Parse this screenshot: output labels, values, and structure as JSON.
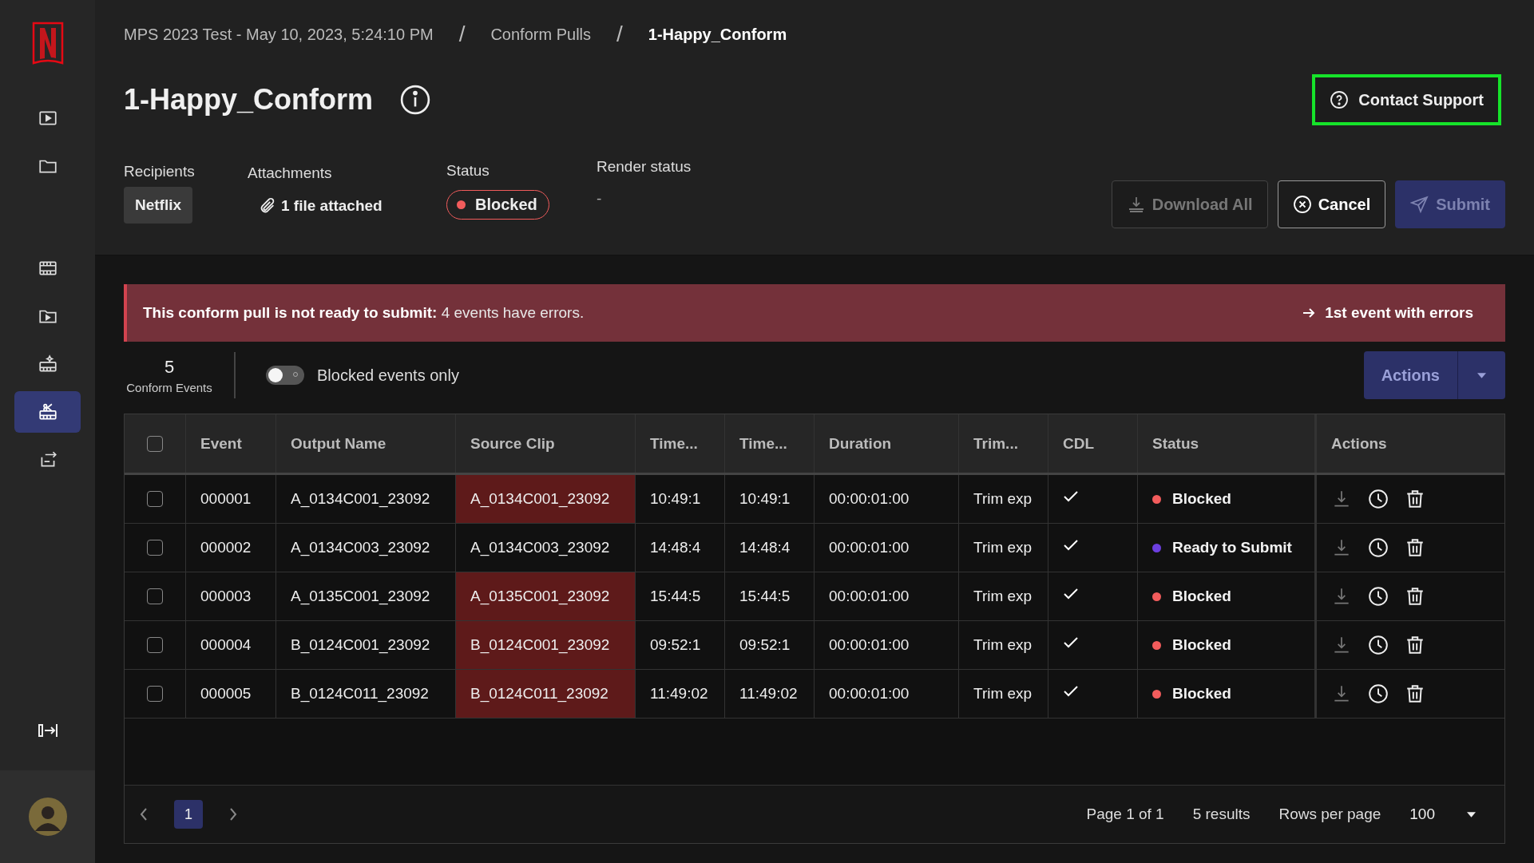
{
  "sidebar": {
    "items": [
      {
        "selected": false
      },
      {
        "selected": false
      },
      {
        "selected": false
      },
      {
        "selected": false
      },
      {
        "selected": false
      },
      {
        "selected": true
      },
      {
        "selected": false
      }
    ]
  },
  "breadcrumb": [
    "MPS 2023 Test - May 10, 2023, 5:24:10 PM",
    "Conform Pulls",
    "1-Happy_Conform"
  ],
  "separator": "/",
  "title": "1-Happy_Conform",
  "contact_support": "Contact Support",
  "meta": {
    "recipients_label": "Recipients",
    "recipient": "Netflix",
    "attachments_label": "Attachments",
    "attachments": "1 file attached",
    "status_label": "Status",
    "status": "Blocked",
    "render_label": "Render status",
    "render": "-"
  },
  "buttons": [
    {
      "kind": "download",
      "label": "Download All",
      "disabled": true
    },
    {
      "kind": "cancel",
      "label": "Cancel",
      "disabled": false
    },
    {
      "kind": "submit",
      "label": "Submit",
      "disabled": true
    }
  ],
  "banner": {
    "message": "**This conform pull is not ready to submit:** 4 events have errors.",
    "link": "1st event with errors"
  },
  "count": {
    "value": "5",
    "label": "Conform Events"
  },
  "toggle": {
    "label": "Blocked events only",
    "on": false
  },
  "actions": "Actions",
  "table": {
    "select_all": {
      "checked": false
    },
    "columns": [
      "Event",
      "Output Name",
      "Source Clip",
      "Time...",
      "Time...",
      "Duration",
      "Trim...",
      "CDL",
      "Status",
      "Actions"
    ],
    "rows": [
      {
        "checked": false,
        "event": "000001",
        "output_name": "A_0134C001_23092",
        "source_clip": "A_0134C001_23092",
        "source_error": true,
        "time_1": "10:49:1",
        "time_2": "10:49:1",
        "duration": "00:00:01:00",
        "trim": "Trim exp",
        "cdl": true,
        "status": "Blocked",
        "color": "#f25c5c"
      },
      {
        "checked": false,
        "event": "000002",
        "output_name": "A_0134C003_23092",
        "source_clip": "A_0134C003_23092",
        "source_error": false,
        "time_1": "14:48:4",
        "time_2": "14:48:4",
        "duration": "00:00:01:00",
        "trim": "Trim exp",
        "cdl": true,
        "status": "Ready to Submit",
        "color": "#6c3fe0"
      },
      {
        "checked": false,
        "event": "000003",
        "output_name": "A_0135C001_23092",
        "source_clip": "A_0135C001_23092",
        "source_error": true,
        "time_1": "15:44:5",
        "time_2": "15:44:5",
        "duration": "00:00:01:00",
        "trim": "Trim exp",
        "cdl": true,
        "status": "Blocked",
        "color": "#f25c5c"
      },
      {
        "checked": false,
        "event": "000004",
        "output_name": "B_0124C001_23092",
        "source_clip": "B_0124C001_23092",
        "source_error": true,
        "time_1": "09:52:1",
        "time_2": "09:52:1",
        "duration": "00:00:01:00",
        "trim": "Trim exp",
        "cdl": true,
        "status": "Blocked",
        "color": "#f25c5c"
      },
      {
        "checked": false,
        "event": "000005",
        "output_name": "B_0124C011_23092",
        "source_clip": "B_0124C011_23092",
        "source_error": true,
        "time_1": "11:49:02",
        "time_2": "11:49:02",
        "duration": "00:00:01:00",
        "trim": "Trim exp",
        "cdl": true,
        "status": "Blocked",
        "color": "#f25c5c"
      }
    ]
  },
  "pagination": {
    "pages": [
      {
        "label": "1",
        "selected": true
      }
    ],
    "page_info": "Page 1 of 1",
    "results": "5 results",
    "rows_label": "Rows per page",
    "rows_value": "100"
  }
}
